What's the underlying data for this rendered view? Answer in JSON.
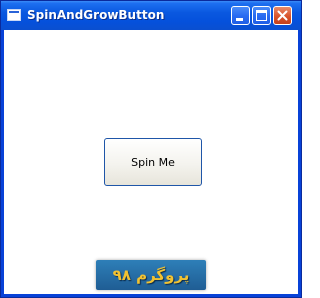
{
  "window": {
    "title": "SpinAndGrowButton"
  },
  "main": {
    "spin_button_label": "Spin Me"
  },
  "watermark": {
    "text": "پروگرم ۹۸"
  },
  "icons": {
    "app": "window-app-icon",
    "minimize": "minimize-icon",
    "maximize": "maximize-icon",
    "close": "close-icon"
  },
  "colors": {
    "titlebar": "#0551dc",
    "close_button": "#d9542c",
    "button_border": "#1f56a8",
    "watermark_bg": "#1f5d94",
    "watermark_text": "#f1c232"
  }
}
